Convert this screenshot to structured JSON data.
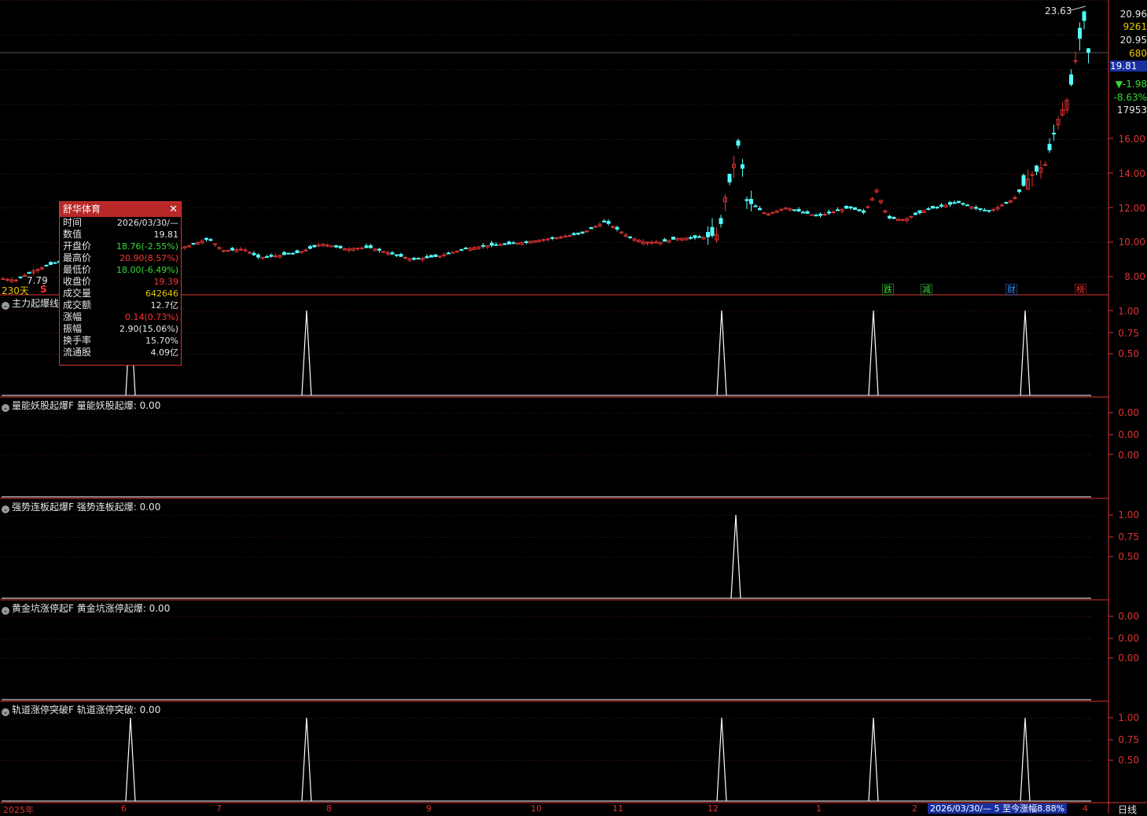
{
  "info_panel": {
    "title": "舒华体育",
    "close": "✕",
    "rows": [
      {
        "k": "时间",
        "v": "2026/03/30/—",
        "c": "#e6e6e6"
      },
      {
        "k": "数值",
        "v": "19.81",
        "c": "#e6e6e6"
      },
      {
        "k": "开盘价",
        "v": "18.76(-2.55%)",
        "c": "#33dd33"
      },
      {
        "k": "最高价",
        "v": "20.90(8.57%)",
        "c": "#ff3333"
      },
      {
        "k": "最低价",
        "v": "18.00(-6.49%)",
        "c": "#33dd33"
      },
      {
        "k": "收盘价",
        "v": "19.39",
        "c": "#ff3333"
      },
      {
        "k": "成交量",
        "v": "642646",
        "c": "#e6c800"
      },
      {
        "k": "成交额",
        "v": "12.7亿",
        "c": "#e6e6e6"
      },
      {
        "k": "涨幅",
        "v": "0.14(0.73%)",
        "c": "#ff3333"
      },
      {
        "k": "振幅",
        "v": "2.90(15.06%)",
        "c": "#e6e6e6"
      },
      {
        "k": "换手率",
        "v": "15.70%",
        "c": "#e6e6e6"
      },
      {
        "k": "流通股",
        "v": "4.09亿",
        "c": "#e6e6e6"
      }
    ]
  },
  "main_chart": {
    "price_axis": [
      "16.00",
      "14.00",
      "12.00",
      "10.00",
      "8.00"
    ],
    "right_info": {
      "price1": "20.96",
      "vol1": "9261",
      "price2": "20.95",
      "vol2": "680",
      "current": "19.81",
      "change": "▼-1.98",
      "change_pct": "-8.63%",
      "amount": "17953"
    },
    "high_label": "23.63",
    "low_label": "7.79",
    "ma_label": "230天",
    "s_marker": "S",
    "badges": [
      {
        "text": "跌",
        "color": "#33dd33"
      },
      {
        "text": "减",
        "color": "#33dd33"
      },
      {
        "text": "财",
        "color": "#3399ff"
      },
      {
        "text": "榜",
        "color": "#ff3333"
      }
    ]
  },
  "panels": [
    {
      "name": "主力起爆线",
      "legend": "",
      "value": "",
      "axis": [
        "1.00",
        "0.75",
        "0.50"
      ]
    },
    {
      "name": "量能妖股起爆F",
      "legend": "量能妖股起爆:",
      "value": "0.00",
      "axis": [
        "0.00",
        "0.00",
        "0.00"
      ]
    },
    {
      "name": "强势连板起爆F",
      "legend": "强势连板起爆:",
      "value": "0.00",
      "axis": [
        "1.00",
        "0.75",
        "0.50"
      ]
    },
    {
      "name": "黄金坑涨停起F",
      "legend": "黄金坑涨停起爆:",
      "value": "0.00",
      "axis": [
        "0.00",
        "0.00",
        "0.00"
      ]
    },
    {
      "name": "轨道涨停突破F",
      "legend": "轨道涨停突破:",
      "value": "0.00",
      "axis": [
        "1.00",
        "0.75",
        "0.50"
      ]
    }
  ],
  "x_axis": [
    "2025年",
    "6",
    "7",
    "8",
    "9",
    "10",
    "11",
    "12",
    "1",
    "2",
    "4"
  ],
  "status_bar": "2026/03/30/— 5 至今涨幅8.88%",
  "period_button": "日线"
}
